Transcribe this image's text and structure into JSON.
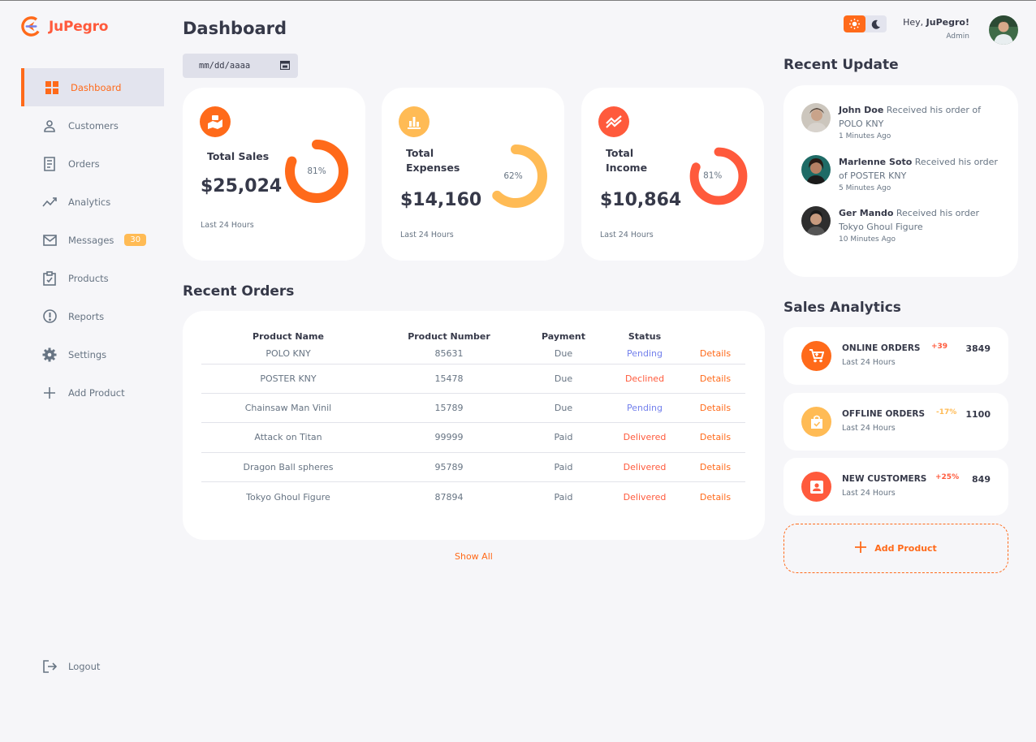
{
  "brand": {
    "name": "JuPegro"
  },
  "sidebar": {
    "items": [
      {
        "label": "Dashboard",
        "icon": "grid-icon"
      },
      {
        "label": "Customers",
        "icon": "user-icon"
      },
      {
        "label": "Orders",
        "icon": "receipt-icon"
      },
      {
        "label": "Analytics",
        "icon": "analytics-icon"
      },
      {
        "label": "Messages",
        "icon": "mail-icon",
        "badge": "30"
      },
      {
        "label": "Products",
        "icon": "clipboard-icon"
      },
      {
        "label": "Reports",
        "icon": "report-icon"
      },
      {
        "label": "Settings",
        "icon": "gear-icon"
      },
      {
        "label": "Add Product",
        "icon": "plus-icon"
      }
    ],
    "logout": "Logout"
  },
  "header": {
    "title": "Dashboard",
    "date_placeholder": "mm/dd/aaaa",
    "greeting_prefix": "Hey, ",
    "user_name": "JuPegro!",
    "role": "Admin"
  },
  "stats": [
    {
      "label_line1": "Total Sales",
      "label_line2": "",
      "value": "$25,024",
      "percent_label": "81%",
      "percent": 81,
      "footer": "Last 24 Hours",
      "color": "#ff6a1a"
    },
    {
      "label_line1": "Total",
      "label_line2": "Expenses",
      "value": "$14,160",
      "percent_label": "62%",
      "percent": 62,
      "footer": "Last 24 Hours",
      "color": "#ffbb55"
    },
    {
      "label_line1": "Total",
      "label_line2": "Income",
      "value": "$10,864",
      "percent_label": "81%",
      "percent": 81,
      "footer": "Last 24 Hours",
      "color": "#ff5a3c"
    }
  ],
  "recent_orders": {
    "title": "Recent Orders",
    "columns": [
      "Product Name",
      "Product Number",
      "Payment",
      "Status",
      ""
    ],
    "rows": [
      {
        "name": "POLO KNY",
        "number": "85631",
        "payment": "Due",
        "status": "Pending",
        "action": "Details"
      },
      {
        "name": "POSTER KNY",
        "number": "15478",
        "payment": "Due",
        "status": "Declined",
        "action": "Details"
      },
      {
        "name": "Chainsaw Man Vinil",
        "number": "15789",
        "payment": "Due",
        "status": "Pending",
        "action": "Details"
      },
      {
        "name": "Attack on Titan",
        "number": "99999",
        "payment": "Paid",
        "status": "Delivered",
        "action": "Details"
      },
      {
        "name": "Dragon Ball spheres",
        "number": "95789",
        "payment": "Paid",
        "status": "Delivered",
        "action": "Details"
      },
      {
        "name": "Tokyo Ghoul Figure",
        "number": "87894",
        "payment": "Paid",
        "status": "Delivered",
        "action": "Details"
      }
    ],
    "show_all": "Show All"
  },
  "recent_update": {
    "title": "Recent Update",
    "items": [
      {
        "name": "John Doe",
        "text": " Received his order of POLO KNY",
        "time": "1 Minutes Ago"
      },
      {
        "name": "Marlenne Soto",
        "text": " Received his order of POSTER KNY",
        "time": "5 Minutes Ago"
      },
      {
        "name": "Ger Mando",
        "text": " Received his order Tokyo Ghoul Figure",
        "time": "10 Minutes Ago"
      }
    ]
  },
  "sales_analytics": {
    "title": "Sales Analytics",
    "items": [
      {
        "title": "ONLINE ORDERS",
        "sub": "Last 24 Hours",
        "change": "+39",
        "value": "3849",
        "color": "#ff6a1a",
        "change_color": "#ff5a3c"
      },
      {
        "title": "OFFLINE ORDERS",
        "sub": "Last 24 Hours",
        "change": "-17%",
        "value": "1100",
        "color": "#ffbb55",
        "change_color": "#ffbb55"
      },
      {
        "title": "NEW CUSTOMERS",
        "sub": "Last 24 Hours",
        "change": "+25%",
        "value": "849",
        "color": "#ff5a3c",
        "change_color": "#ff5a3c"
      }
    ],
    "add_product": "Add Product"
  }
}
